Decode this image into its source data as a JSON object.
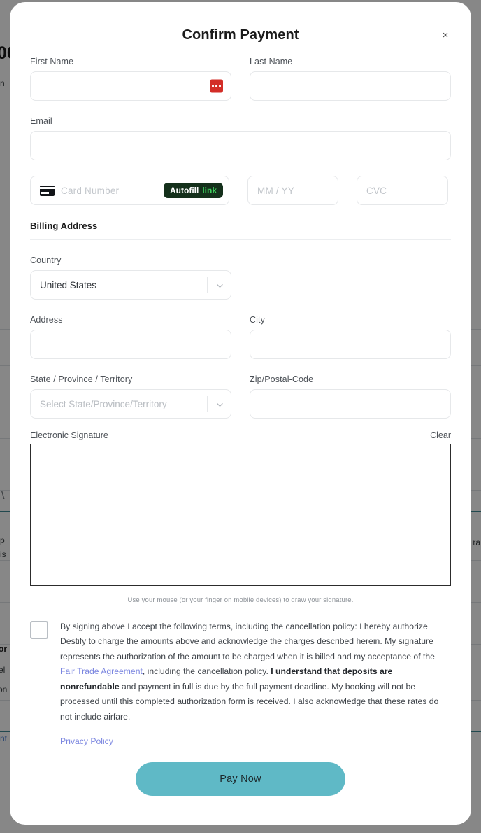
{
  "modal": {
    "title": "Confirm Payment",
    "close_label": "×"
  },
  "form": {
    "first_name": {
      "label": "First Name",
      "value": "",
      "placeholder": ""
    },
    "last_name": {
      "label": "Last Name",
      "value": "",
      "placeholder": ""
    },
    "email": {
      "label": "Email",
      "value": "",
      "placeholder": ""
    },
    "card_number": {
      "placeholder": "Card Number",
      "value": "",
      "icon": "credit-card-icon"
    },
    "expiry": {
      "placeholder": "MM / YY",
      "value": ""
    },
    "cvc": {
      "placeholder": "CVC",
      "value": ""
    },
    "autofill": {
      "word1": "Autofill",
      "word2": "link"
    },
    "password_manager_icon": "lastpass-icon"
  },
  "billing": {
    "section_title": "Billing Address",
    "country": {
      "label": "Country",
      "value": "United States"
    },
    "address": {
      "label": "Address",
      "value": "",
      "placeholder": ""
    },
    "city": {
      "label": "City",
      "value": "",
      "placeholder": ""
    },
    "state": {
      "label": "State / Province / Territory",
      "value": "",
      "placeholder": "Select State/Province/Territory"
    },
    "zip": {
      "label": "Zip/Postal-Code",
      "value": "",
      "placeholder": ""
    }
  },
  "signature": {
    "label": "Electronic Signature",
    "clear_label": "Clear",
    "hint": "Use your mouse (or your finger on mobile devices) to draw your signature."
  },
  "terms": {
    "part1": "By signing above I accept the following terms, including the cancellation policy: I hereby authorize Destify to charge the amounts above and acknowledge the charges described herein. My signature represents the authorization of the amount to be charged when it is billed and my acceptance of the ",
    "link1": "Fair Trade Agreement",
    "part2": ", including the cancellation policy. ",
    "bold1": "I understand that deposits are nonrefundable",
    "part3": " and payment in full is due by the full payment deadline. My booking will not be processed until this completed authorization form is received. I also acknowledge that these rates do not include airfare.",
    "privacy_label": "Privacy Policy",
    "checked": false
  },
  "actions": {
    "pay_label": "Pay Now"
  },
  "colors": {
    "pay_button": "#5fb9c6",
    "link": "#7b86e0",
    "autofill_badge_bg": "#14301b",
    "autofill_link_green": "#3ecf5c",
    "password_icon_red": "#d32d27",
    "scrim": "rgba(0,0,0,0.47)"
  },
  "background_page": {
    "big_text": "00",
    "snippets": [
      "n",
      "\\",
      "p",
      "is",
      "or",
      "el",
      "on",
      "nt",
      "ra"
    ]
  }
}
